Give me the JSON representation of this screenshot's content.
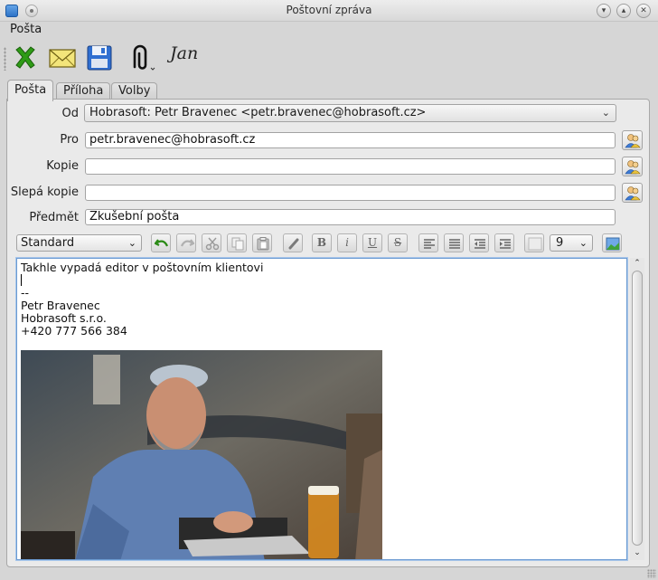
{
  "window": {
    "title": "Poštovní zpráva"
  },
  "menu": {
    "items": [
      "Pošta"
    ]
  },
  "toolbar": {
    "signature_text": "Jan"
  },
  "tabs": [
    {
      "label": "Pošta",
      "active": true
    },
    {
      "label": "Příloha",
      "active": false
    },
    {
      "label": "Volby",
      "active": false
    }
  ],
  "form": {
    "from_label": "Od",
    "from_value": "Hobrasoft: Petr Bravenec <petr.bravenec@hobrasoft.cz>",
    "to_label": "Pro",
    "to_value": "petr.bravenec@hobrasoft.cz",
    "cc_label": "Kopie",
    "cc_value": "",
    "bcc_label": "Slepá kopie",
    "bcc_value": "",
    "subject_label": "Předmět",
    "subject_value": "Zkušební pošta"
  },
  "format": {
    "paragraph_style": "Standard",
    "font_size": "9"
  },
  "editor": {
    "lines": [
      "Takhle vypadá editor v poštovním klientovi",
      "",
      "--",
      "Petr Bravenec",
      "Hobrasoft s.r.o.",
      "+420 777 566 384"
    ]
  },
  "icons": {
    "discard": "x-icon",
    "send": "envelope-icon",
    "save": "floppy-icon",
    "attach": "paperclip-icon",
    "signature": "signature-icon"
  },
  "colors": {
    "discard_green": "#2e9b16",
    "envelope_yellow": "#f3e57a",
    "floppy_blue": "#2f6fd1",
    "editor_focus": "#6c9bd2"
  }
}
